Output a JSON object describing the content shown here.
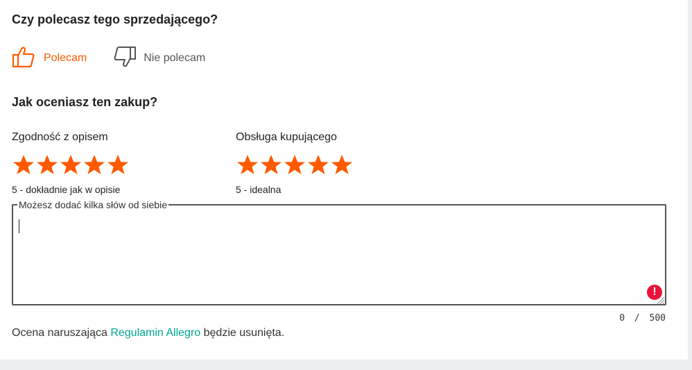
{
  "recommend": {
    "heading": "Czy polecasz tego sprzedającego?",
    "yes_label": "Polecam",
    "no_label": "Nie polecam",
    "selected": "yes",
    "yes_icon": "thumb-up-icon",
    "no_icon": "thumb-down-icon"
  },
  "rating": {
    "heading": "Jak oceniasz ten zakup?",
    "criteria": [
      {
        "title": "Zgodność z opisem",
        "stars": 5,
        "max": 5,
        "description": "5 - dokładnie jak w opisie"
      },
      {
        "title": "Obsługa kupującego",
        "stars": 5,
        "max": 5,
        "description": "5 - idealna"
      }
    ]
  },
  "comment": {
    "legend": "Możesz dodać kilka słów od siebie",
    "value": "",
    "count": "0",
    "separator": "/",
    "limit": "500",
    "error_icon": "!"
  },
  "footer": {
    "before": "Ocena naruszająca ",
    "link": "Regulamin Allegro",
    "after": " będzie usunięta."
  },
  "colors": {
    "accent": "#ff5a00",
    "link": "#00a790",
    "error": "#e8143c"
  }
}
